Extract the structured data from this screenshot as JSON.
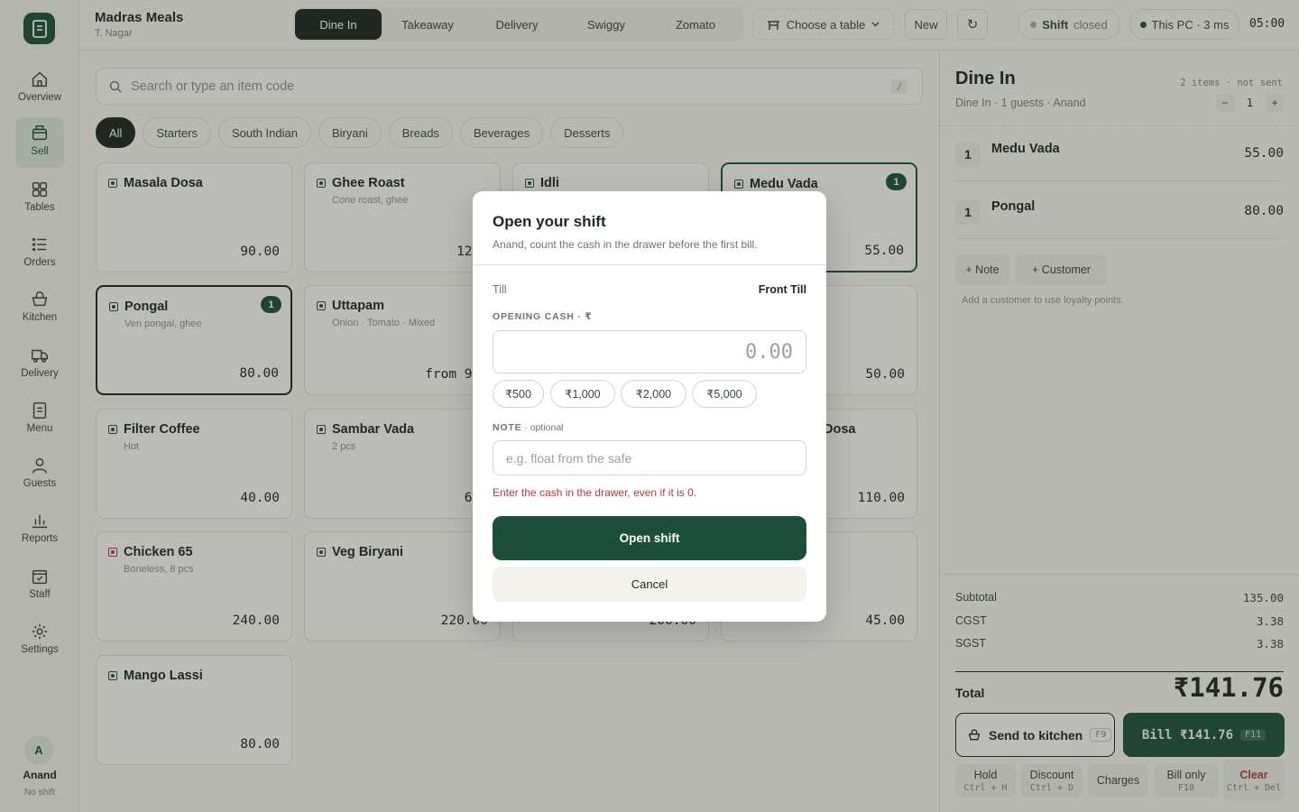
{
  "store": {
    "name": "Madras Meals",
    "location": "T. Nagar"
  },
  "order_types": [
    "Dine In",
    "Takeaway",
    "Delivery",
    "Swiggy",
    "Zomato"
  ],
  "topbar": {
    "choose_table": "Choose a table",
    "new_label": "New",
    "refresh_glyph": "↻",
    "shift_label": "Shift",
    "shift_status": "closed",
    "pc_status": "This PC · 3 ms",
    "clock": "05:00"
  },
  "search": {
    "placeholder": "Search or type an item code",
    "shortcut": "/"
  },
  "categories": [
    "All",
    "Starters",
    "South Indian",
    "Biryani",
    "Breads",
    "Beverages",
    "Desserts"
  ],
  "nav": [
    {
      "label": "Overview",
      "icon": "home-icon"
    },
    {
      "label": "Sell",
      "icon": "register-icon"
    },
    {
      "label": "Tables",
      "icon": "grid-icon"
    },
    {
      "label": "Orders",
      "icon": "list-icon"
    },
    {
      "label": "Kitchen",
      "icon": "basket-icon"
    },
    {
      "label": "Delivery",
      "icon": "truck-icon"
    },
    {
      "label": "Menu",
      "icon": "document-icon"
    },
    {
      "label": "Guests",
      "icon": "person-icon"
    },
    {
      "label": "Reports",
      "icon": "bar-chart-icon"
    },
    {
      "label": "Staff",
      "icon": "calendar-check-icon"
    },
    {
      "label": "Settings",
      "icon": "gear-icon"
    }
  ],
  "user": {
    "initial": "A",
    "name": "Anand",
    "shift": "No shift"
  },
  "menu_items": [
    {
      "name": "Masala Dosa",
      "desc": "",
      "price": "90.00",
      "veg": true,
      "qty": ""
    },
    {
      "name": "Ghee Roast",
      "desc": "Cone roast, ghee",
      "price": "120.",
      "veg": true,
      "qty": ""
    },
    {
      "name": "Idli",
      "desc": "",
      "price": "",
      "veg": true,
      "qty": ""
    },
    {
      "name": "Medu Vada",
      "desc": "",
      "price": "55.00",
      "veg": true,
      "qty": "1"
    },
    {
      "name": "Pongal",
      "desc": "Ven pongal, ghee",
      "price": "80.00",
      "veg": true,
      "qty": "1"
    },
    {
      "name": "Uttapam",
      "desc": "Onion · Tomato · Mixed",
      "price": "from 95.",
      "veg": true,
      "qty": ""
    },
    {
      "name": "",
      "desc": "",
      "price": "",
      "veg": true,
      "qty": ""
    },
    {
      "name": "",
      "desc": "",
      "price": "50.00",
      "veg": true,
      "qty": ""
    },
    {
      "name": "Filter Coffee",
      "desc": "Hot",
      "price": "40.00",
      "veg": true,
      "qty": ""
    },
    {
      "name": "Sambar Vada",
      "desc": "2 pcs",
      "price": "65.",
      "veg": true,
      "qty": ""
    },
    {
      "name": "",
      "desc": "",
      "price": "",
      "veg": true,
      "qty": ""
    },
    {
      "name": "Dosa",
      "desc": "",
      "price": "110.00",
      "veg": true,
      "qty": ""
    },
    {
      "name": "Chicken 65",
      "desc": "Boneless, 8 pcs",
      "price": "240.00",
      "veg": false,
      "qty": ""
    },
    {
      "name": "Veg Biryani",
      "desc": "",
      "price": "220.00",
      "veg": true,
      "qty": ""
    },
    {
      "name": "",
      "desc": "",
      "price": "200.00",
      "veg": true,
      "qty": ""
    },
    {
      "name": "",
      "desc": "",
      "price": "45.00",
      "veg": true,
      "qty": ""
    },
    {
      "name": "Mango Lassi",
      "desc": "",
      "price": "80.00",
      "veg": true,
      "qty": ""
    }
  ],
  "cart": {
    "title": "Dine In",
    "meta": "Dine In · 1 guests · Anand",
    "count": "2 items · not sent",
    "guests": "1",
    "minus": "−",
    "plus": "+",
    "lines": [
      {
        "qty": "1",
        "name": "Medu Vada",
        "price": "55.00"
      },
      {
        "qty": "1",
        "name": "Pongal",
        "price": "80.00"
      }
    ],
    "note_btn": "+ Note",
    "customer_btn": "+ Customer",
    "hint": "Add a customer to use loyalty points.",
    "subtotal_label": "Subtotal",
    "subtotal": "135.00",
    "cgst_label": "CGST",
    "cgst": "3.38",
    "sgst_label": "SGST",
    "sgst": "3.38",
    "total_label": "Total",
    "total": "₹141.76",
    "send_kitchen": "Send to kitchen",
    "send_kitchen_key": "F9",
    "bill_label": "Bill ₹141.76",
    "bill_key": "F11",
    "hold": "Hold",
    "hold_key": "Ctrl + H",
    "discount": "Discount",
    "discount_key": "Ctrl + D",
    "charges": "Charges",
    "bill_only": "Bill only",
    "bill_only_key": "F10",
    "clear": "Clear",
    "clear_key": "Ctrl + Del"
  },
  "modal": {
    "title": "Open your shift",
    "subtitle": "Anand, count the cash in the drawer before the first bill.",
    "till_label": "Till",
    "till_value": "Front Till",
    "cash_label": "OPENING CASH · ₹",
    "cash_placeholder": "0.00",
    "quick_amounts": [
      "₹500",
      "₹1,000",
      "₹2,000",
      "₹5,000"
    ],
    "note_label": "NOTE",
    "note_optional": " · optional",
    "note_placeholder": "e.g. float from the safe",
    "error": "Enter the cash in the drawer, even if it is 0.",
    "open_btn": "Open shift",
    "cancel_btn": "Cancel"
  },
  "colors": {
    "brand": "#1d4f3a",
    "error": "#b23a3a",
    "dark": "#1f2622"
  }
}
